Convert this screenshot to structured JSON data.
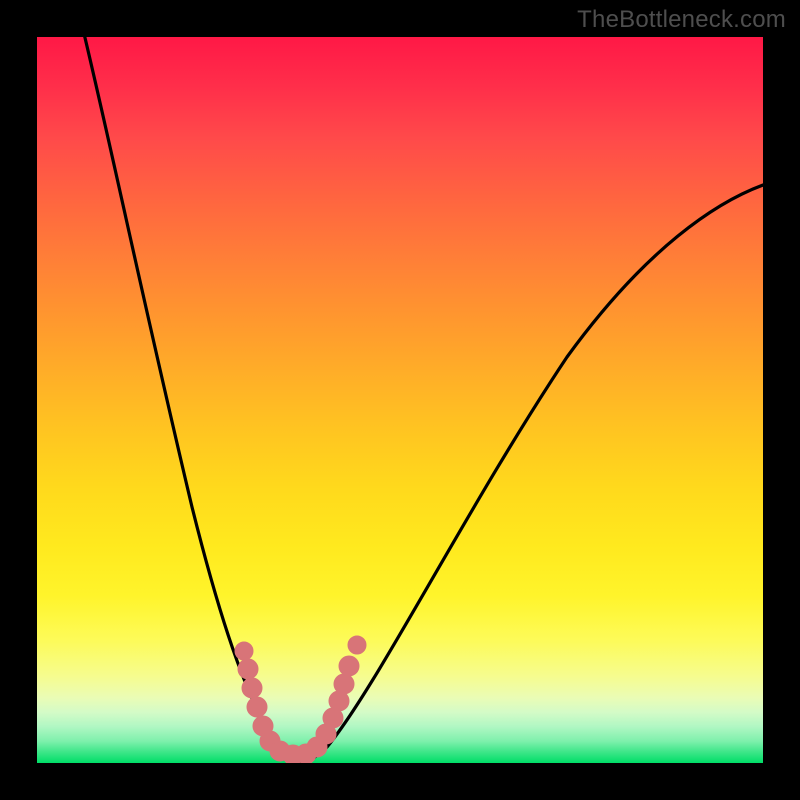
{
  "watermark": "TheBottleneck.com",
  "colors": {
    "frame": "#000000",
    "curve": "#000000",
    "markers": "#d77277",
    "gradient_top": "#ff1846",
    "gradient_bottom": "#00de67"
  },
  "chart_data": {
    "type": "line",
    "title": "",
    "xlabel": "",
    "ylabel": "",
    "xlim": [
      0,
      100
    ],
    "ylim": [
      0,
      100
    ],
    "x": [
      0,
      2,
      4,
      6,
      8,
      10,
      12,
      14,
      16,
      18,
      20,
      22,
      24,
      26,
      28,
      30,
      32,
      34,
      36,
      38,
      40,
      45,
      50,
      55,
      60,
      65,
      70,
      75,
      80,
      85,
      90,
      95,
      100
    ],
    "series": [
      {
        "name": "bottleneck-curve",
        "values": [
          100,
          93,
          85,
          77,
          69,
          61,
          53,
          45,
          38,
          31,
          25,
          20,
          15,
          10,
          6,
          3,
          1,
          0,
          0.5,
          2,
          5,
          12,
          21,
          30,
          39,
          47,
          54,
          60,
          66,
          71,
          75,
          78,
          80
        ]
      }
    ],
    "markers": {
      "name": "highlight-cluster",
      "points": [
        {
          "x": 27,
          "y": 13.5
        },
        {
          "x": 28,
          "y": 10
        },
        {
          "x": 28.5,
          "y": 6
        },
        {
          "x": 29.5,
          "y": 3
        },
        {
          "x": 31,
          "y": 1
        },
        {
          "x": 32.5,
          "y": 0.3
        },
        {
          "x": 34,
          "y": 0.2
        },
        {
          "x": 35.5,
          "y": 0.3
        },
        {
          "x": 37,
          "y": 1
        },
        {
          "x": 38.5,
          "y": 3
        },
        {
          "x": 39.5,
          "y": 6
        },
        {
          "x": 40,
          "y": 10
        },
        {
          "x": 40.5,
          "y": 13.5
        }
      ]
    },
    "annotations": []
  }
}
